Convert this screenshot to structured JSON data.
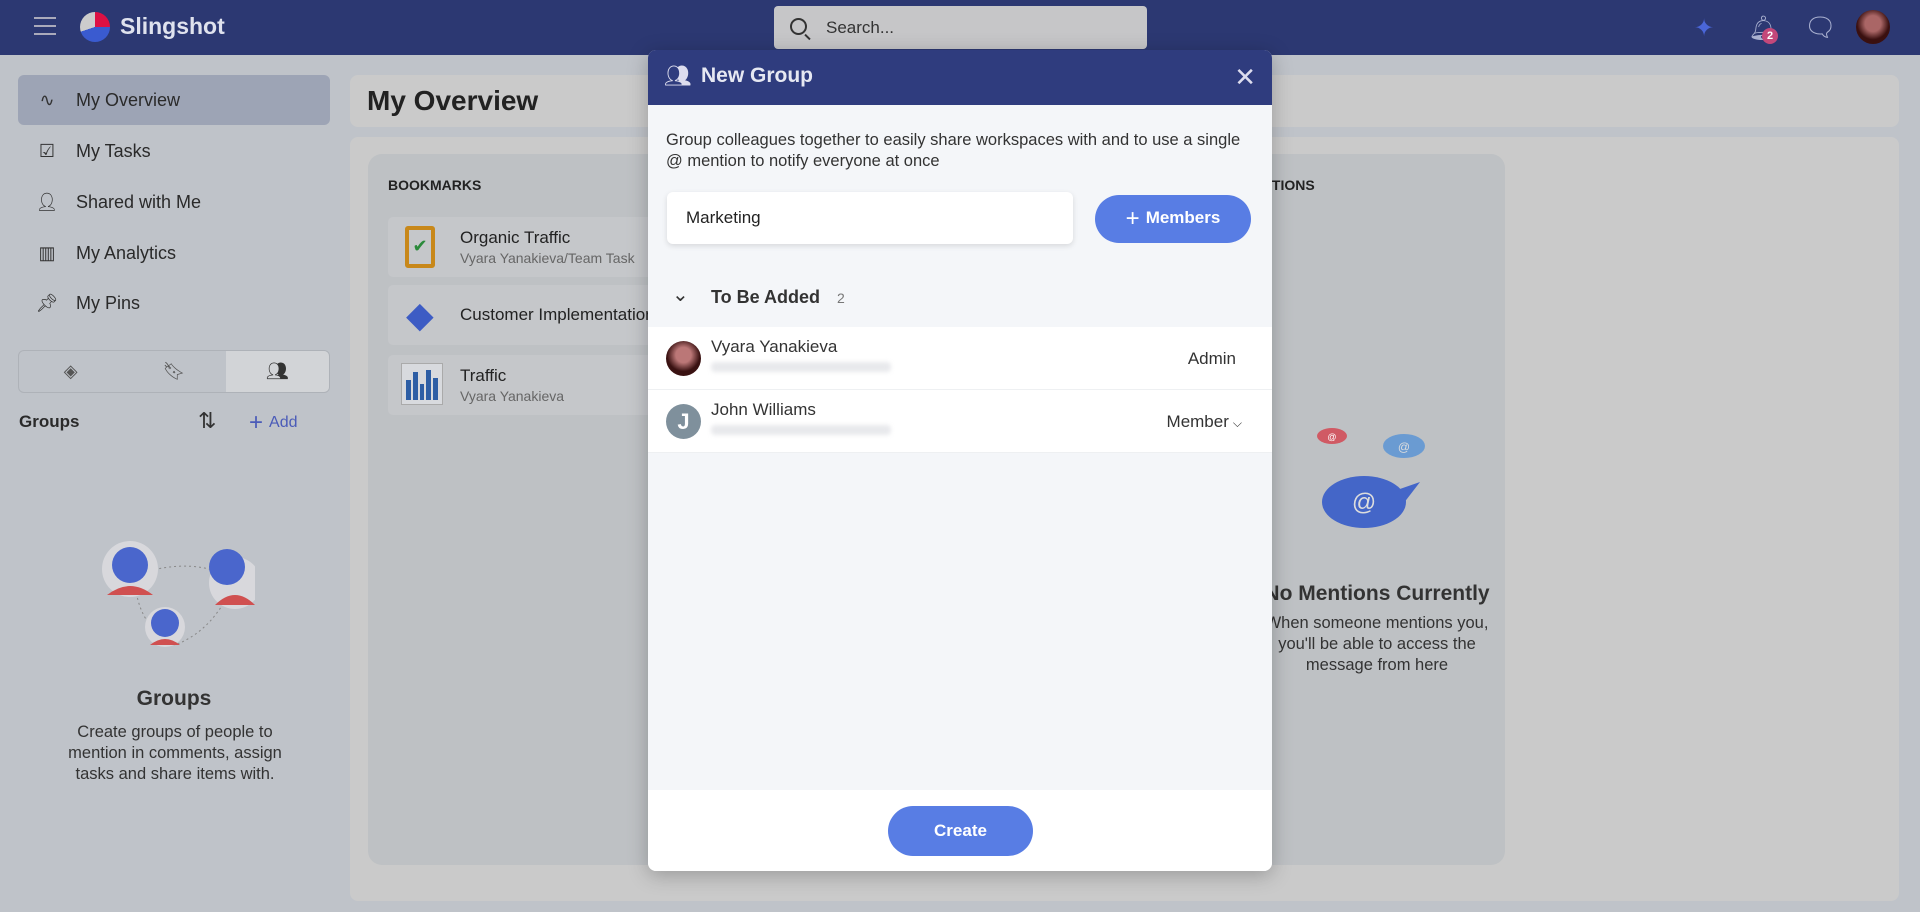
{
  "app": {
    "name": "Slingshot",
    "search_placeholder": "Search...",
    "notification_count": "2",
    "accent": "#587de4",
    "header_color": "#2c3872"
  },
  "icons": {
    "menu": "hamburger-icon",
    "sparkle": "sparkle-icon",
    "bell": "bell-icon",
    "chat": "chat-icon"
  },
  "sidebar": {
    "items": [
      {
        "label": "My Overview",
        "icon": "pulse-icon",
        "active": true
      },
      {
        "label": "My Tasks",
        "icon": "clipboard-check-icon"
      },
      {
        "label": "Shared with Me",
        "icon": "user-check-icon"
      },
      {
        "label": "My Analytics",
        "icon": "bar-chart-icon"
      },
      {
        "label": "My Pins",
        "icon": "pin-icon"
      }
    ],
    "tabs": [
      {
        "icon": "layers-icon"
      },
      {
        "icon": "bookmark-icon"
      },
      {
        "icon": "users-icon",
        "active": true
      }
    ],
    "groups_label": "Groups",
    "add_label": "Add",
    "empty": {
      "title": "Groups",
      "text": "Create groups of people to mention in comments, assign tasks and share items with."
    }
  },
  "main": {
    "title": "My Overview",
    "bookmarks": {
      "heading": "BOOKMARKS",
      "items": [
        {
          "title": "Organic Traffic",
          "subtitle": "Vyara Yanakieva/Team Task"
        },
        {
          "title": "Customer Implementation",
          "subtitle": ""
        },
        {
          "title": "Traffic",
          "subtitle": "Vyara Yanakieva"
        }
      ]
    },
    "mentions": {
      "heading": "ITIONS",
      "empty_title": "No Mentions Currently",
      "empty_text": "When someone mentions you, you'll be able to access the message from here"
    }
  },
  "modal": {
    "title": "New Group",
    "description": "Group colleagues together to easily share workspaces with and to use a single @ mention to notify everyone at once",
    "name_value": "Marketing",
    "members_button": "Members",
    "section": {
      "label": "To Be Added",
      "count": "2"
    },
    "members": [
      {
        "name": "Vyara Yanakieva",
        "role": "Admin",
        "initial": ""
      },
      {
        "name": "John Williams",
        "role": "Member",
        "initial": "J"
      }
    ],
    "create_button": "Create"
  }
}
